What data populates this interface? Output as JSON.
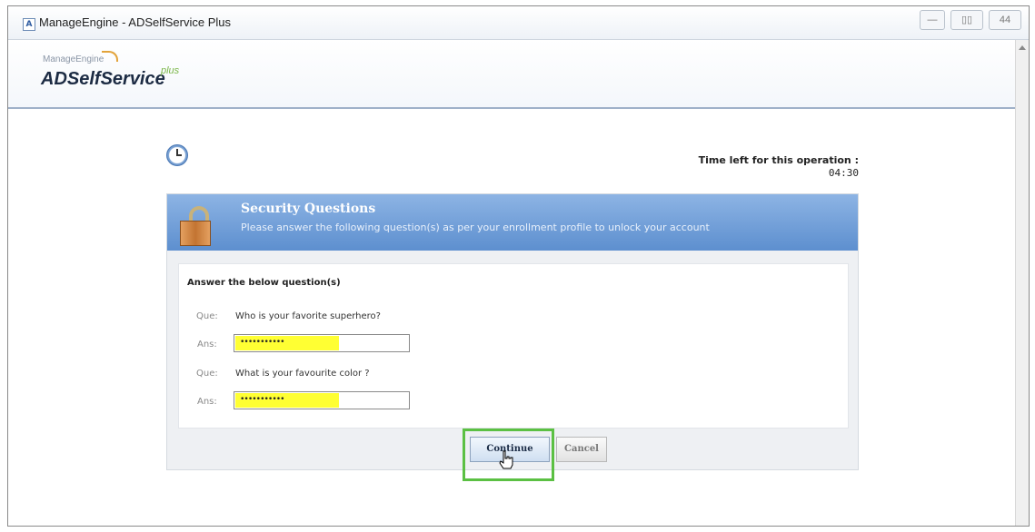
{
  "window": {
    "title": "ManageEngine - ADSelfService Plus",
    "app_icon_glyph": "A",
    "controls": [
      "—",
      "▯▯",
      "44"
    ]
  },
  "header": {
    "logo_small": "ManageEngine",
    "logo_main": "ADSelfService",
    "logo_plus": "plus"
  },
  "timer": {
    "label": "Time left for this operation :",
    "value": "04:30"
  },
  "panel": {
    "title": "Security Questions",
    "subtitle": "Please answer the following question(s) as per your enrollment profile to unlock your account"
  },
  "form": {
    "heading": "Answer the below question(s)",
    "que_label": "Que:",
    "ans_label": "Ans:",
    "questions": [
      {
        "question": "Who is your favorite superhero?",
        "answer_masked": "•••••••••••"
      },
      {
        "question": "What is your favourite color ?",
        "answer_masked": "•••••••••••"
      }
    ]
  },
  "buttons": {
    "continue": "Continue",
    "cancel": "Cancel"
  },
  "colors": {
    "panel_header": "#5d8fcf",
    "highlight": "#5bc043",
    "autofill": "#ffff33"
  }
}
